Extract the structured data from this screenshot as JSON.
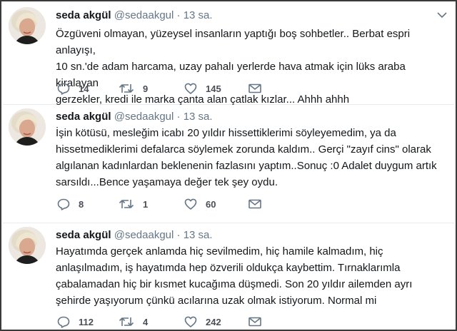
{
  "colors": {
    "text": "#14171a",
    "muted": "#657786",
    "icon": "#657786",
    "divider": "#e6ecf0"
  },
  "icons": [
    "reply-icon",
    "retweet-icon",
    "like-icon",
    "message-icon",
    "chevron-down-icon",
    "avatar"
  ],
  "tweets": [
    {
      "name": "seda akgül",
      "handle": "@sedaakgul",
      "dot": "·",
      "time": "13 sa.",
      "lines": [
        "Özgüveni olmayan, yüzeysel insanların yaptığı boş sohbetler.. Berbat espri anlayışı,",
        "10 sn.'de adam harcama, uzay pahalı yerlerde hava atmak için lüks araba kiralayan",
        "gerzekler, kredi ile marka çanta alan çatlak kızlar... Ahhh ahhh"
      ],
      "replies": "14",
      "retweets": "9",
      "likes": "145"
    },
    {
      "name": "seda akgül",
      "handle": "@sedaakgul",
      "dot": "·",
      "time": "13 sa.",
      "lines": [
        "İşin kötüsü, mesleğim icabı 20 yıldır hissettiklerimi söyleyemedim, ya da",
        "hissetmediklerimi defalarca söylemek zorunda kaldım.. Gerçi \"zayıf cins\" olarak",
        "algılanan kadınlardan beklenenin  fazlasını yaptım..Sonuç :0 Adalet duygum artık",
        "sarsıldı...Bence yaşamaya değer tek şey oydu."
      ],
      "replies": "8",
      "retweets": "1",
      "likes": "60"
    },
    {
      "name": "seda akgül",
      "handle": "@sedaakgul",
      "dot": "·",
      "time": "13 sa.",
      "lines": [
        "Hayatımda gerçek anlamda hiç sevilmedim, hiç hamile kalmadım, hiç",
        "anlaşılmadım, iş hayatımda hep özverili oldukça kaybettim. Tırnaklarımla",
        "çabalamadan  hiç bir kısmet kucağıma düşmedi. Son 20  yıldır ailemden ayrı",
        "şehirde yaşıyorum çünkü acılarına uzak olmak istiyorum. Normal mi"
      ],
      "replies": "112",
      "retweets": "4",
      "likes": "242"
    }
  ]
}
